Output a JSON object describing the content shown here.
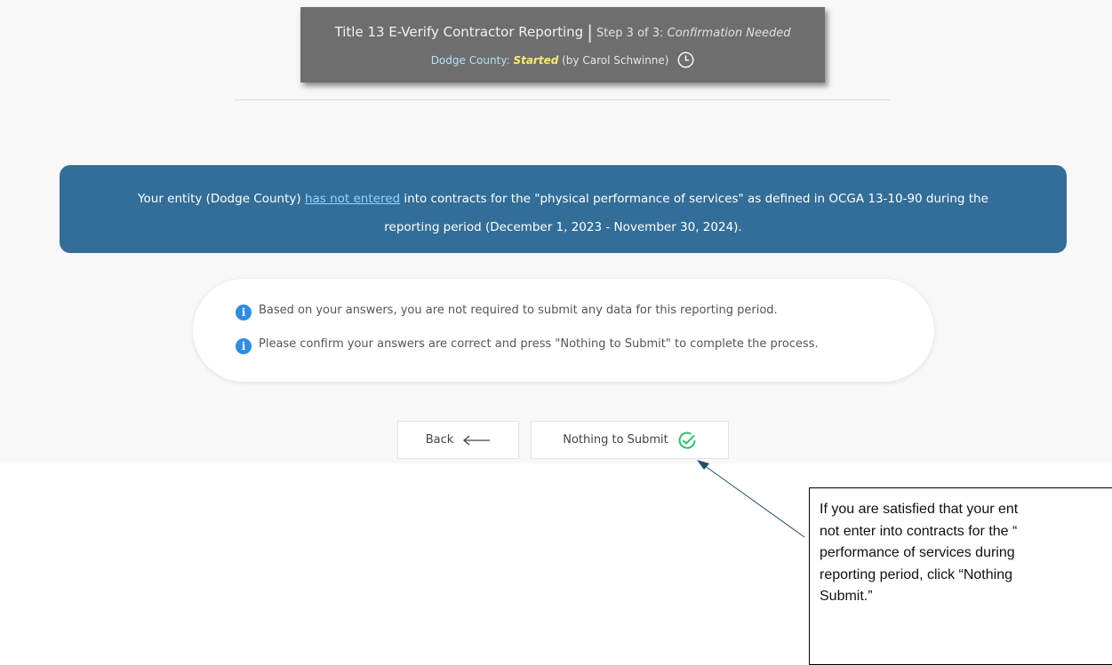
{
  "header": {
    "title": "Title 13 E-Verify Contractor Reporting",
    "separator": "|",
    "step_label": "Step 3 of 3:",
    "step_status": "Confirmation Needed",
    "entity": "Dodge County:",
    "status_word": "Started",
    "started_by": "(by Carol Schwinne)"
  },
  "banner": {
    "pre": "Your entity (Dodge County) ",
    "link": "has not entered",
    "post": " into contracts for the \"physical performance of services\" as defined in OCGA 13-10-90 during the reporting period (December 1, 2023 - November 30, 2024)."
  },
  "info": {
    "line1": "Based on your answers, you are not required to submit any data for this reporting period.",
    "line2": "Please confirm your answers are correct and press \"Nothing to Submit\" to complete the process."
  },
  "buttons": {
    "back": "Back",
    "submit": "Nothing to Submit"
  },
  "callout": {
    "text": "If you are satisfied that your ent\nnot enter into contracts for the “\nperformance of services during\nreporting period, click “Nothing\nSubmit.”"
  },
  "colors": {
    "header_bg": "#6e6e6e",
    "banner_bg": "#336e98",
    "status_word": "#ffe86b",
    "info_icon": "#2e8de0",
    "check_icon": "#2fbf71",
    "arrow": "#1f4e6e"
  }
}
